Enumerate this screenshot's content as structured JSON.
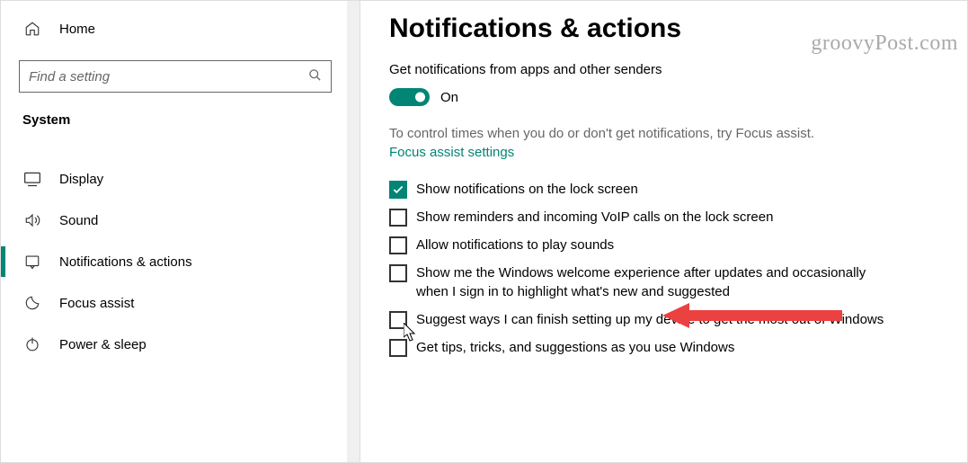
{
  "sidebar": {
    "home_label": "Home",
    "search_placeholder": "Find a setting",
    "section_header": "System",
    "items": [
      {
        "label": "Display"
      },
      {
        "label": "Sound"
      },
      {
        "label": "Notifications & actions"
      },
      {
        "label": "Focus assist"
      },
      {
        "label": "Power & sleep"
      }
    ]
  },
  "content": {
    "page_title": "Notifications & actions",
    "get_notifications_label": "Get notifications from apps and other senders",
    "toggle_state": "On",
    "help_text": "To control times when you do or don't get notifications, try Focus assist.",
    "focus_link": "Focus assist settings",
    "options": [
      {
        "label": "Show notifications on the lock screen",
        "checked": true
      },
      {
        "label": "Show reminders and incoming VoIP calls on the lock screen",
        "checked": false
      },
      {
        "label": "Allow notifications to play sounds",
        "checked": false
      },
      {
        "label": "Show me the Windows welcome experience after updates and occasionally when I sign in to highlight what's new and suggested",
        "checked": false
      },
      {
        "label": "Suggest ways I can finish setting up my device to get the most out of Windows",
        "checked": false
      },
      {
        "label": "Get tips, tricks, and suggestions as you use Windows",
        "checked": false
      }
    ]
  },
  "watermark": "groovyPost.com"
}
